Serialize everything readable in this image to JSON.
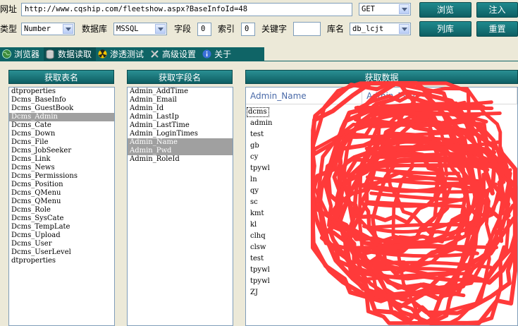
{
  "toolbar": {
    "url_label": "网址",
    "url_value": "http://www.cqship.com/fleetshow.aspx?BaseInfoId=48",
    "method": "GET",
    "browse_label": "浏览",
    "inject_label": "注入",
    "type_label": "类型",
    "type_value": "Number",
    "db_label": "数据库",
    "db_value": "MSSQL",
    "field_label": "字段",
    "field_value": "0",
    "index_label": "索引",
    "index_value": "0",
    "keyword_label": "关键字",
    "keyword_value": "",
    "libname_label": "库名",
    "libname_value": "db_lcjt",
    "list_db_label": "列库",
    "reset_label": "重置"
  },
  "tabs": [
    {
      "label": "浏览器",
      "icon": "globe-icon"
    },
    {
      "label": "数据读取",
      "icon": "database-icon"
    },
    {
      "label": "渗透测试",
      "icon": "radiation-icon"
    },
    {
      "label": "高级设置",
      "icon": "tools-icon"
    },
    {
      "label": "关于",
      "icon": "info-icon"
    }
  ],
  "tables_panel": {
    "title": "获取表名",
    "items": [
      "dtproperties",
      "Dcms_BaseInfo",
      "Dcms_GuestBook",
      "Dcms_Admin",
      "Dcms_Cate",
      "Dcms_Down",
      "Dcms_File",
      "Dcms_JobSeeker",
      "Dcms_Link",
      "Dcms_News",
      "Dcms_Permissions",
      "Dcms_Position",
      "Dcms_QMenu",
      "Dcms_QMenu",
      "Dcms_Role",
      "Dcms_SysCate",
      "Dcms_TempLate",
      "Dcms_Upload",
      "Dcms_User",
      "Dcms_UserLevel",
      "dtproperties"
    ],
    "selected_index": 3
  },
  "fields_panel": {
    "title": "获取字段名",
    "items": [
      "Admin_AddTime",
      "Admin_Email",
      "Admin_Id",
      "Admin_LastIp",
      "Admin_LastTime",
      "Admin_LoginTimes",
      "Admin_Name",
      "Admin_Pwd",
      "Admin_RoleId"
    ],
    "selected_indexes": [
      6,
      7
    ]
  },
  "data_panel": {
    "title": "获取数据",
    "columns": [
      "Admin_Name",
      "Admin_Pwd"
    ],
    "rows": [
      "dcms",
      "admin",
      "test",
      "gb",
      "cy",
      "tpywl",
      "ln",
      "qy",
      "sc",
      "kmt",
      "kl",
      "clhq",
      "clsw",
      "test",
      "tpywl",
      "tpywl",
      "ZJ"
    ],
    "redaction_color": "#ff3a3a"
  }
}
